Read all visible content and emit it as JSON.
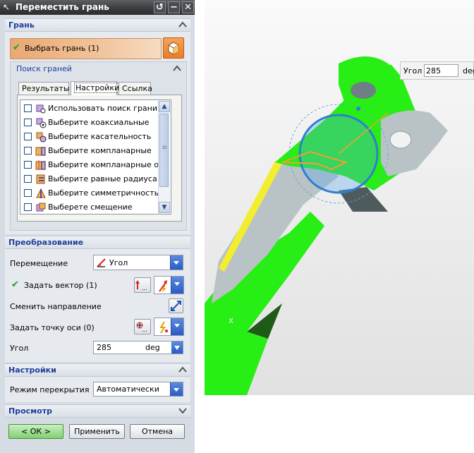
{
  "dialog": {
    "title": "Переместить грань",
    "title_buttons": [
      "↺",
      "−",
      "✕"
    ]
  },
  "face_group": {
    "header": "Грань",
    "select_label": "Выбрать грань (1)",
    "find_header": "Поиск граней",
    "tabs": [
      "Результаты",
      "Настройки",
      "Ссылка"
    ],
    "active_tab": "Настройки",
    "items": [
      {
        "label": "Использовать поиск грани",
        "icon": "face-search-icon"
      },
      {
        "label": "Выберите коаксиальные",
        "icon": "coaxial-icon"
      },
      {
        "label": "Выберите касательность",
        "icon": "tangent-icon"
      },
      {
        "label": "Выберите компланарные",
        "icon": "coplanar-icon"
      },
      {
        "label": "Выберите компланарные оси",
        "icon": "coplanar-axes-icon"
      },
      {
        "label": "Выберите равные радиуса",
        "icon": "equal-radius-icon"
      },
      {
        "label": "Выберите симметричность",
        "icon": "symmetric-icon"
      },
      {
        "label": "Выберете смещение",
        "icon": "offset-icon"
      }
    ]
  },
  "transform_group": {
    "header": "Преобразование",
    "motion_label": "Перемещение",
    "motion_value": "Угол",
    "vector_label": "Задать вектор (1)",
    "reverse_label": "Сменить направление",
    "axis_point_label": "Задать точку оси (0)",
    "angle_label": "Угол",
    "angle_value": "285",
    "angle_unit": "deg"
  },
  "settings_group": {
    "header": "Настройки",
    "overlap_label": "Режим перекрытия",
    "overlap_value": "Автоматически"
  },
  "preview_group": {
    "header": "Просмотр"
  },
  "buttons": {
    "ok": "< ОК >",
    "apply": "Применить",
    "cancel": "Отмена"
  },
  "viewport": {
    "angle_label": "Угол",
    "angle_value": "285",
    "angle_unit": "deg",
    "axis_label": "X"
  },
  "colors": {
    "part_green": "#27ee14",
    "part_gray": "#b9c3c6",
    "handle_blue": "#5aa6e8",
    "selected_yellow": "#f3ee2d",
    "accent_orange": "#eea56b"
  }
}
